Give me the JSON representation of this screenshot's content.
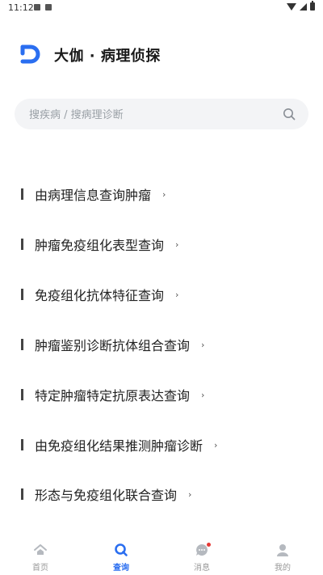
{
  "status_bar": {
    "time": "11:12"
  },
  "header": {
    "title": "大伽 · 病理侦探"
  },
  "search": {
    "placeholder": "搜疾病 / 搜病理诊断"
  },
  "menu": {
    "items": [
      {
        "label": "由病理信息查询肿瘤",
        "chevron": "›"
      },
      {
        "label": "肿瘤免疫组化表型查询",
        "chevron": "›"
      },
      {
        "label": "免疫组化抗体特征查询",
        "chevron": "›"
      },
      {
        "label": "肿瘤鉴别诊断抗体组合查询",
        "chevron": "›"
      },
      {
        "label": "特定肿瘤特定抗原表达查询",
        "chevron": "›"
      },
      {
        "label": "由免疫组化结果推测肿瘤诊断",
        "chevron": "›"
      },
      {
        "label": "形态与免疫组化联合查询",
        "chevron": "›"
      }
    ]
  },
  "bottom_nav": {
    "items": [
      {
        "label": "首页",
        "icon": "home-icon"
      },
      {
        "label": "查询",
        "icon": "search-icon",
        "active": true
      },
      {
        "label": "消息",
        "icon": "message-icon",
        "badge": true
      },
      {
        "label": "我的",
        "icon": "profile-icon"
      }
    ]
  },
  "colors": {
    "accent": "#2a6ef0",
    "badge": "#e53935"
  }
}
